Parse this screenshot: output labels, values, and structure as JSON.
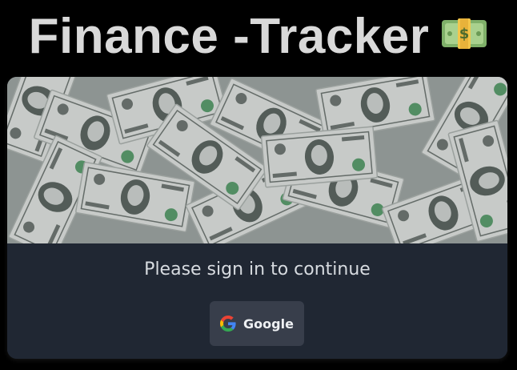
{
  "page": {
    "title": "Finance -Tracker",
    "title_emoji_icon": "dollar-banknote-icon"
  },
  "hero": {
    "image_icon": "dollar-bills-photo"
  },
  "login": {
    "prompt": "Please sign in to continue",
    "google_button_label": "Google",
    "google_icon": "google-g-icon"
  },
  "colors": {
    "background": "#000000",
    "card": "#202733",
    "button": "#383e4b",
    "title": "#d9d9d9"
  }
}
